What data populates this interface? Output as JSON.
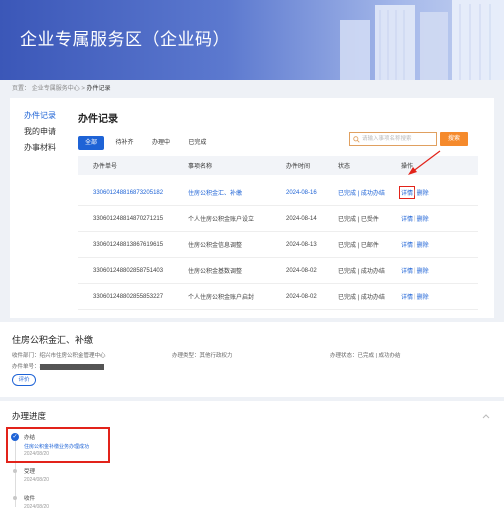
{
  "banner": {
    "title": "企业专属服务区（企业码）"
  },
  "breadcrumb": [
    "页置：",
    "企业专属服务中心",
    "办件记录"
  ],
  "sidebar": {
    "items": [
      {
        "label": "办件记录",
        "active": true
      },
      {
        "label": "我的申请",
        "active": false
      },
      {
        "label": "办事材料",
        "active": false
      }
    ]
  },
  "records": {
    "title": "办件记录",
    "tabs": [
      {
        "label": "全部",
        "active": true
      },
      {
        "label": "待补齐",
        "active": false
      },
      {
        "label": "办理中",
        "active": false
      },
      {
        "label": "已完成",
        "active": false
      }
    ],
    "search_placeholder": "请输入事项名称搜索",
    "search_button": "搜索",
    "columns": [
      "办件单号",
      "事项名称",
      "办件时间",
      "状态",
      "操作"
    ],
    "rows": [
      {
        "id": "330601248816873205182",
        "name": "住房公积金汇、补缴",
        "time": "2024-08-16",
        "status": "已完成 | 成功办结",
        "highlight": true
      },
      {
        "id": "330601248814870271215",
        "name": "个人住房公积金账户设立",
        "time": "2024-08-14",
        "status": "已完成 | 已受件",
        "highlight": false
      },
      {
        "id": "330601248813867619615",
        "name": "住房公积金信息调整",
        "time": "2024-08-13",
        "status": "已完成 | 已邮件",
        "highlight": false
      },
      {
        "id": "330601248802858751403",
        "name": "住房公积金基数调整",
        "time": "2024-08-02",
        "status": "已完成 | 成功办结",
        "highlight": false
      },
      {
        "id": "330601248802855853227",
        "name": "个人住房公积金账户启封",
        "time": "2024-08-02",
        "status": "已完成 | 成功办结",
        "highlight": false
      }
    ],
    "action_detail": "详情",
    "action_delete": "删除"
  },
  "detail": {
    "title": "住房公积金汇、补缴",
    "dept_label": "收件部门：绍兴市住房公积金管理中心",
    "type_label": "办理类型：其他行政权力",
    "status_label": "办理状态：已完成 | 成功办结",
    "id_label": "办件单号：",
    "id_value": "330601248816873205182",
    "evaluate_label": "评价"
  },
  "progress": {
    "title": "办理进度",
    "steps": [
      {
        "name": "办结",
        "note": "住房公积金补缴业务办理成功",
        "date": "2024/08/20",
        "done": true
      },
      {
        "name": "受理",
        "date": "2024/08/20",
        "done": false
      },
      {
        "name": "收件",
        "date": "2024/08/20",
        "done": false
      }
    ]
  },
  "colors": {
    "primary": "#1e63d6",
    "accent": "#f58a2c",
    "highlight": "#e2231a"
  }
}
